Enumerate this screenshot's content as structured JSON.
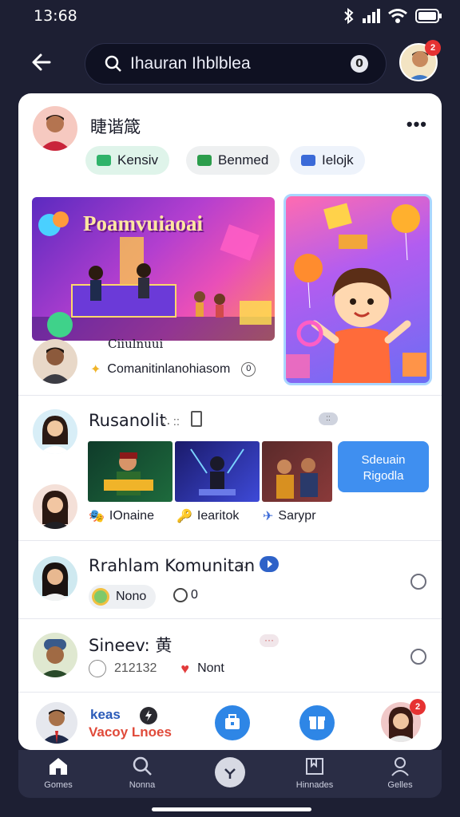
{
  "status": {
    "time": "13:68"
  },
  "search": {
    "query": "Ihauran Ihblblea",
    "clear_label": "0"
  },
  "top_avatar_badge": "2",
  "post": {
    "author": "睫谐箴",
    "chips": [
      {
        "label": "Kensiv",
        "bg": "#dff4ea",
        "icon": "#2fb36a"
      },
      {
        "label": "Benmed",
        "bg": "#eef0f1",
        "icon": "#2c9d4c"
      },
      {
        "label": "Ielojk",
        "bg": "#eef3fb",
        "icon": "#3b6ad8"
      }
    ],
    "banner_title": "Poamvuiaoai",
    "subtitle": "Ciiulnuui",
    "caption": "Comanitinlanohiasom",
    "caption_count": "0"
  },
  "section1": {
    "title": "Rusanolit",
    "meta": "∴ ::",
    "pill": "::",
    "join_button": [
      "Sdeuain",
      "Rigodla"
    ],
    "tags": [
      {
        "label": "IOnaine",
        "icon": "🎭"
      },
      {
        "label": "Iearitok",
        "icon": "🔑"
      },
      {
        "label": "Sarypr",
        "icon": "✈"
      }
    ]
  },
  "section2": {
    "title": "Rrahlam Komunitan",
    "meta": "∴",
    "tag1": "Nono",
    "tag2": "0"
  },
  "section3": {
    "title": "Sineev: 黄",
    "pill": "···",
    "count": "212132",
    "tag": "Nont"
  },
  "bottom": {
    "line1": "keas",
    "line2": "Vacoy Lnoes",
    "badge": "2"
  },
  "tabs": [
    {
      "label": "Gomes"
    },
    {
      "label": "Nonna"
    },
    {
      "label": ""
    },
    {
      "label": "Hinnades"
    },
    {
      "label": "Gelles"
    }
  ]
}
